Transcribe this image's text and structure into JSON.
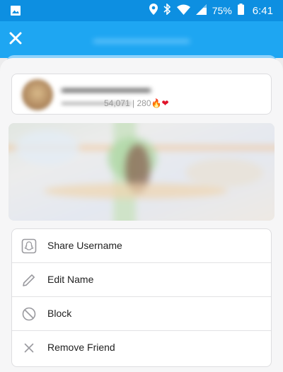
{
  "status_bar": {
    "battery_percent": "75%",
    "time": "6:41",
    "icons": [
      "image-icon",
      "location-icon",
      "bluetooth-icon",
      "wifi-icon",
      "signal-icon",
      "battery-icon"
    ]
  },
  "header": {
    "close_icon": "close-icon",
    "accent_color": "#1ea6f2"
  },
  "profile": {
    "stats": "54,071 | 280",
    "fire_emoji": "🔥",
    "heart_emoji": "❤"
  },
  "actions": [
    {
      "label": "Share Username",
      "icon": "snapchat-ghost-icon"
    },
    {
      "label": "Edit Name",
      "icon": "pencil-icon"
    },
    {
      "label": "Block",
      "icon": "block-icon"
    },
    {
      "label": "Remove Friend",
      "icon": "x-icon"
    }
  ]
}
